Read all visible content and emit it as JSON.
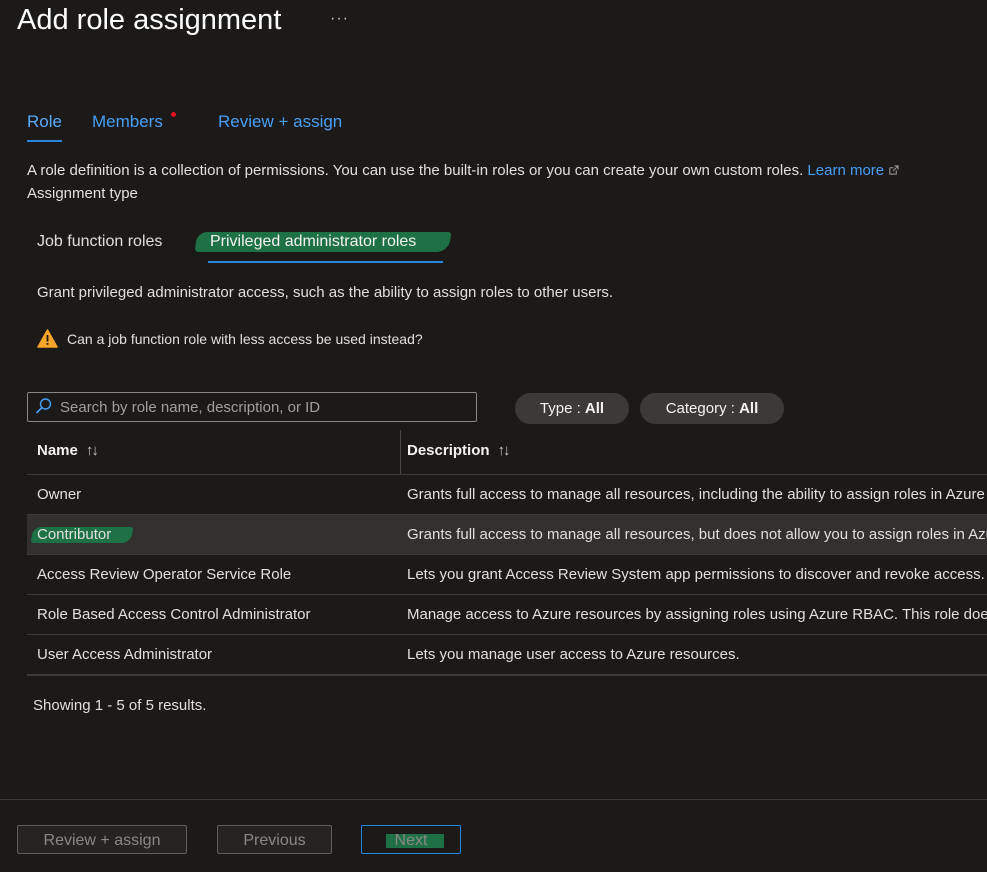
{
  "page": {
    "title": "Add role assignment",
    "more_label": "···"
  },
  "tabs": [
    {
      "label": "Role"
    },
    {
      "label": "Members"
    },
    {
      "label": "Review + assign"
    }
  ],
  "description": {
    "text": "A role definition is a collection of permissions. You can use the built-in roles or you can create your own custom roles.",
    "learn_more": "Learn more"
  },
  "assignment_type": {
    "label": "Assignment type",
    "options": [
      "Job function roles",
      "Privileged administrator roles"
    ],
    "selected": "Privileged administrator roles"
  },
  "grant_text": "Grant privileged administrator access, such as the ability to assign roles to other users.",
  "warning_text": "Can a job function role with less access be used instead?",
  "search": {
    "placeholder": "Search by role name, description, or ID"
  },
  "filters": {
    "type": {
      "label": "Type :",
      "value": "All"
    },
    "category": {
      "label": "Category :",
      "value": "All"
    }
  },
  "table": {
    "columns": [
      "Name",
      "Description"
    ],
    "sort_glyph": "↑↓",
    "rows": [
      {
        "name": "Owner",
        "description": "Grants full access to manage all resources, including the ability to assign roles in Azure RBAC."
      },
      {
        "name": "Contributor",
        "description": "Grants full access to manage all resources, but does not allow you to assign roles in Azure RBAC."
      },
      {
        "name": "Access Review Operator Service Role",
        "description": "Lets you grant Access Review System app permissions to discover and revoke access."
      },
      {
        "name": "Role Based Access Control Administrator",
        "description": "Manage access to Azure resources by assigning roles using Azure RBAC. This role does not allow you to manage access."
      },
      {
        "name": "User Access Administrator",
        "description": "Lets you manage user access to Azure resources."
      }
    ],
    "selected_row": "Contributor"
  },
  "results_text": "Showing 1 - 5 of 5 results.",
  "footer": {
    "review_assign": "Review + assign",
    "previous": "Previous",
    "next": "Next"
  },
  "colors": {
    "background": "#1b1a19",
    "accent": "#2886de",
    "link": "#479ef5",
    "highlight": "#1e7145",
    "warning": "#f7a527",
    "notification_dot": "#e81123"
  }
}
